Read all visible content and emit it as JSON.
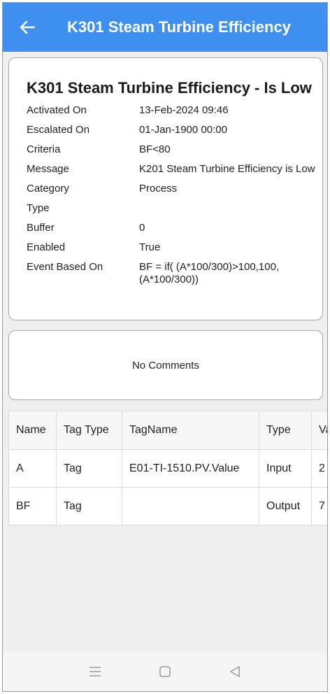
{
  "app_bar": {
    "title": "K301 Steam Turbine Efficiency",
    "back_icon": "arrow-left-icon",
    "color": "#3f8ff0"
  },
  "details": {
    "title": "K301 Steam Turbine Efficiency - Is Low",
    "rows": [
      {
        "label": "Activated On",
        "value": "13-Feb-2024 09:46"
      },
      {
        "label": "Escalated On",
        "value": "01-Jan-1900 00:00"
      },
      {
        "label": "Criteria",
        "value": "BF<80"
      },
      {
        "label": "Message",
        "value": "K201 Steam Turbine Efficiency is Low"
      },
      {
        "label": "Category",
        "value": "Process"
      },
      {
        "label": "Type",
        "value": ""
      },
      {
        "label": "Buffer",
        "value": "0"
      },
      {
        "label": "Enabled",
        "value": "True"
      },
      {
        "label": "Event Based On",
        "value": "BF = if( (A*100/300)>100,100,(A*100/300))"
      }
    ]
  },
  "comments": {
    "empty_text": "No Comments"
  },
  "tag_table": {
    "headers": [
      "Name",
      "Tag Type",
      "TagName",
      "Type",
      "Value"
    ],
    "rows": [
      [
        "A",
        "Tag",
        "E01-TI-1510.PV.Value",
        "Input",
        "2"
      ],
      [
        "BF",
        "Tag",
        "",
        "Output",
        "7"
      ]
    ]
  },
  "nav_bar": {
    "icons": [
      "menu-icon",
      "home-square-icon",
      "back-triangle-icon"
    ]
  }
}
